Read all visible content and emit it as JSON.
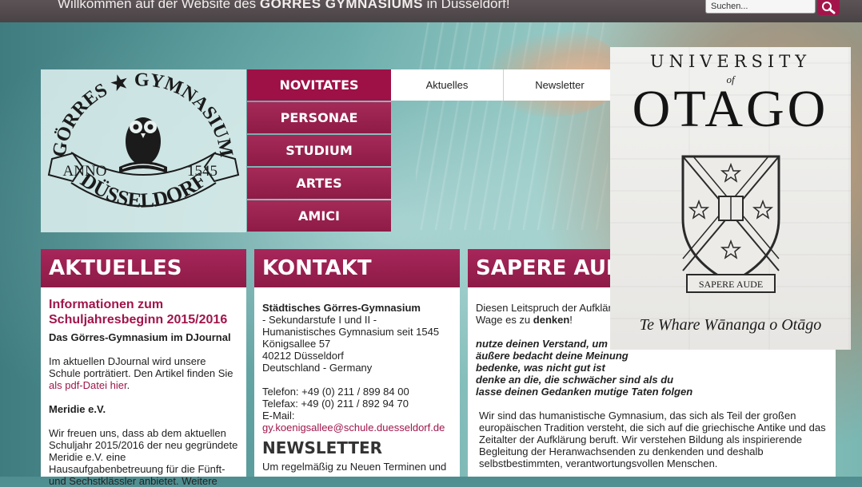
{
  "topbar": {
    "welcome_prefix": "Willkommen auf der Website des ",
    "welcome_school": "GÖRRES GYMNASIUMS",
    "welcome_suffix": " in Düsseldorf!",
    "search_placeholder": "Suchen...",
    "search_icon": "magnifier-icon"
  },
  "logo": {
    "top_text": "GÖRRES ★ GYMNASIUM",
    "anno": "ANNO",
    "year": "1545",
    "city": "DÜSSELDORF"
  },
  "nav": {
    "items": [
      "NOVITATES",
      "PERSONAE",
      "STUDIUM",
      "ARTES",
      "AMICI"
    ],
    "sub_items": [
      "Aktuelles",
      "Newsletter"
    ]
  },
  "aktuelles": {
    "heading": "AKTUELLES",
    "news_title": "Informationen zum Schuljahresbeginn 2015/2016",
    "djournal_title": "Das Görres-Gymnasium im DJournal",
    "djournal_text": "Im aktuellen DJournal wird unsere Schule porträtiert. Den Artikel finden Sie ",
    "djournal_link": "als pdf-Datei hier",
    "djournal_end": ".",
    "meridie_title": "Meridie e.V.",
    "meridie_text": "Wir freuen uns, dass ab dem aktuellen Schuljahr 2015/2016 der neu gegründete Meridie e.V. eine Hausaufgabenbetreuung für die Fünft- und Sechstklässler anbietet. Weitere"
  },
  "kontakt": {
    "heading": "KONTAKT",
    "school_name": "Städtisches Görres-Gymnasium",
    "line1": "- Sekundarstufe I und II -",
    "line2": "Humanistisches Gymnasium seit 1545",
    "street": "Königsallee 57",
    "city": "40212 Düsseldorf",
    "country": "Deutschland - Germany",
    "phone": "Telefon: +49 (0) 211 / 899 84 00",
    "fax": "Telefax: +49 (0) 211 / 892 94 70",
    "email_label": "E-Mail:",
    "email": "gy.koenigsallee@schule.duesseldorf.de",
    "newsletter_heading": "NEWSLETTER",
    "newsletter_text": "Um regelmäßig zu Neuen Terminen und"
  },
  "sapere": {
    "heading": "SAPERE AUDE",
    "intro_start": "Diesen Leitspruch der Aufklär",
    "intro_second_start": "Wage es zu ",
    "intro_denken": "denken",
    "intro_end": "!",
    "poem": [
      "nutze deinen Verstand, um",
      "äußere bedacht deine Meinung",
      "bedenke, was nicht gut ist",
      "denke an die, die schwächer sind als du",
      "lasse deinen Gedanken mutige Taten folgen"
    ],
    "body": "Wir sind das humanistische Gymnasium, das sich als Teil der großen europäischen Tradition versteht, die sich auf die griechische Antike und das Zeitalter der Aufklärung beruft. Wir verstehen Bildung als inspirierende Begleitung der Heranwachsenden zu denkenden und deshalb selbstbestimmten, verantwortungsvollen Menschen."
  },
  "otago": {
    "top": "UNIVERSITY",
    "of": "of",
    "main": "OTAGO",
    "crest_motto": "SAPERE AUDE",
    "motto": "Te Whare Wānanga o Otāgo"
  },
  "colors": {
    "accent": "#9d1146",
    "topbar": "#4f4749"
  }
}
